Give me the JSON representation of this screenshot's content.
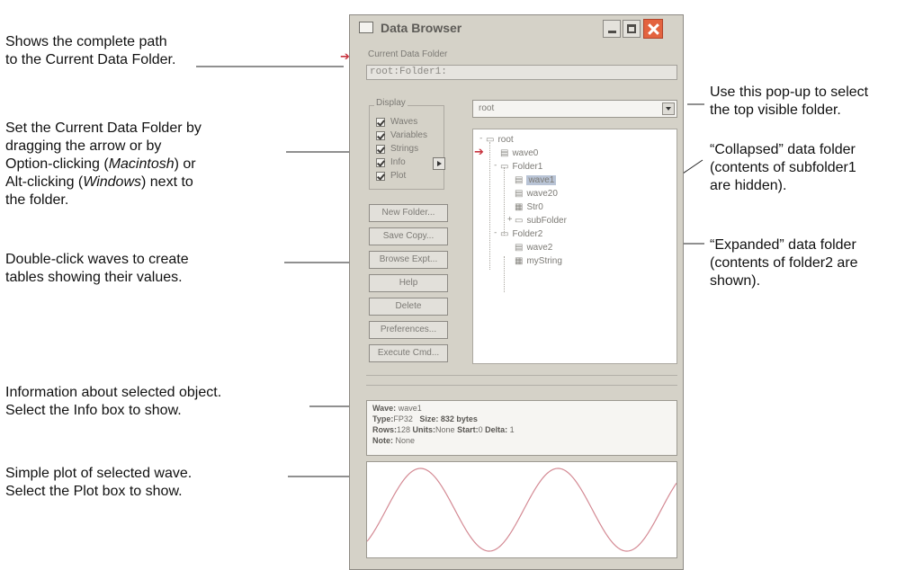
{
  "callouts": [
    {
      "lines": [
        "Shows the complete path",
        "to the Current Data Folder."
      ]
    },
    {
      "lines": [
        "Set the Current Data Folder by",
        "dragging the arrow or by"
      ],
      "line3_pre": "Option-clicking (",
      "line3_em": "Macintosh",
      "line3_post": ") or",
      "line4_pre": "Alt-clicking (",
      "line4_em": "Windows",
      "line4_post": ") next to",
      "line5": "the folder."
    },
    {
      "lines": [
        "Double-click waves to create",
        "tables showing their values."
      ]
    },
    {
      "lines": [
        "Information about selected object.",
        "Select the Info box to show."
      ]
    },
    {
      "lines": [
        "Simple plot of selected wave.",
        "Select the Plot box to show."
      ]
    },
    {
      "lines": [
        "Use this pop-up to select",
        "the top visible folder."
      ]
    },
    {
      "lines": [
        "“Collapsed” data folder",
        "(contents of subfolder1",
        "are hidden)."
      ]
    },
    {
      "lines": [
        "“Expanded” data folder",
        "(contents of folder2 are",
        "shown)."
      ]
    }
  ],
  "window": {
    "title": "Data Browser",
    "current_folder_label": "Current Data Folder",
    "current_folder_path": "root:Folder1:",
    "display_label": "Display",
    "checkboxes": [
      {
        "label": "Waves",
        "checked": true
      },
      {
        "label": "Variables",
        "checked": true
      },
      {
        "label": "Strings",
        "checked": true
      },
      {
        "label": "Info",
        "checked": true
      },
      {
        "label": "Plot",
        "checked": true
      }
    ],
    "buttons": [
      "New Folder...",
      "Save Copy...",
      "Browse Expt...",
      "Help",
      "Delete",
      "Preferences...",
      "Execute Cmd..."
    ],
    "dropdown_value": "root",
    "tree": [
      {
        "label": "root",
        "type": "folder",
        "toggle": "-"
      },
      {
        "label": "wave0",
        "type": "wave"
      },
      {
        "label": "Folder1",
        "type": "folder",
        "toggle": "-"
      },
      {
        "label": "wave1",
        "type": "wave",
        "selected": true
      },
      {
        "label": "wave20",
        "type": "wave"
      },
      {
        "label": "Str0",
        "type": "string"
      },
      {
        "label": "subFolder",
        "type": "folder",
        "toggle": "+"
      },
      {
        "label": "Folder2",
        "type": "folder",
        "toggle": "-"
      },
      {
        "label": "wave2",
        "type": "wave"
      },
      {
        "label": "myString",
        "type": "string"
      }
    ],
    "info": {
      "wave_key": "Wave:",
      "wave_val": "wave1",
      "type_key": "Type:",
      "type_val": "FP32",
      "size_key": "Size:",
      "size_val": "832 bytes",
      "rows_key": "Rows:",
      "rows_val": "128",
      "units_key": "Units:",
      "units_val": "None",
      "start_key": "Start:",
      "start_val": "0",
      "delta_key": "Delta:",
      "delta_val": "1",
      "note_key": "Note:",
      "note_val": "None"
    }
  },
  "colors": {
    "accent_arrow": "#c8333e",
    "plot_line": "#d48a94",
    "close_button": "#e3633f"
  }
}
